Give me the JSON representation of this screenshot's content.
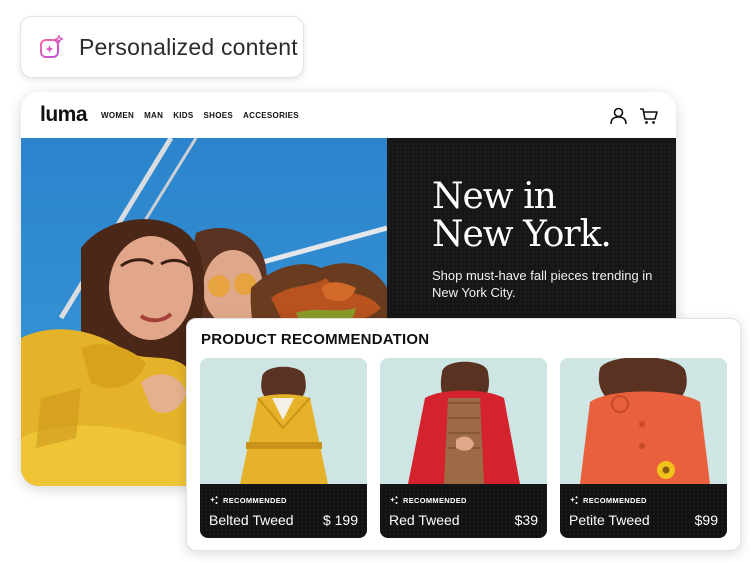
{
  "chip": {
    "label": "Personalized content",
    "icon": "sparkle-icon",
    "accent": "#e0559b"
  },
  "site": {
    "logo": "luma",
    "nav": [
      "WOMEN",
      "MAN",
      "KIDS",
      "SHOES",
      "ACCESORIES"
    ],
    "icons": [
      "user-icon",
      "cart-icon"
    ],
    "hero": {
      "title_line1": "New in",
      "title_line2": "New York.",
      "subtitle": "Shop must-have fall pieces trending in New York City."
    }
  },
  "recommendation": {
    "title": "PRODUCT RECOMMENDATION",
    "badge": "RECOMMENDED",
    "products": [
      {
        "name": "Belted Tweed",
        "price": "$ 199",
        "color": "#e5b22a"
      },
      {
        "name": "Red Tweed",
        "price": "$39",
        "color": "#d4222e"
      },
      {
        "name": "Petite Tweed",
        "price": "$99",
        "color": "#e9603c"
      }
    ]
  }
}
